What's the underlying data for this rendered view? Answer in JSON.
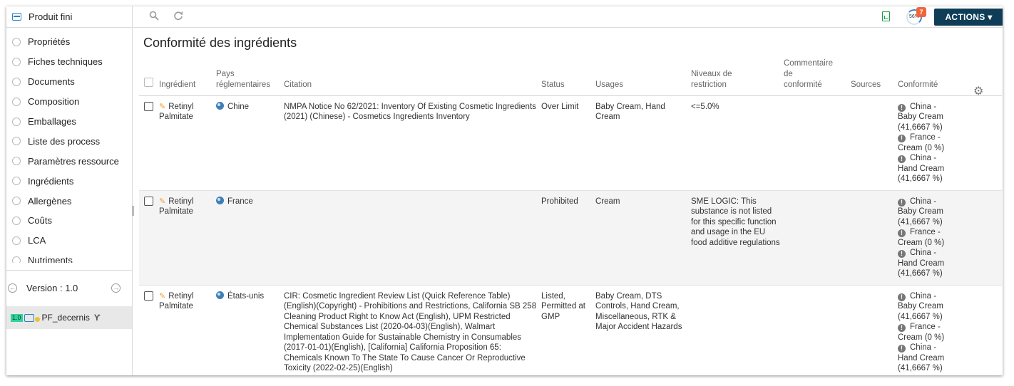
{
  "sidebar": {
    "header": "Produit fini",
    "items": [
      "Propriétés",
      "Fiches techniques",
      "Documents",
      "Composition",
      "Emballages",
      "Liste des process",
      "Paramètres ressource",
      "Ingrédients",
      "Allergènes",
      "Coûts",
      "LCA",
      "Nutriments"
    ],
    "version_label": "Version : 1.0",
    "branch": {
      "version_badge": "1.0",
      "name": "PF_decernis",
      "branch_icon": "Ƴ"
    }
  },
  "toolbar": {
    "search_icon": "magnifier",
    "refresh_icon": "refresh",
    "progress": "56%",
    "notifications": "7",
    "actions_label": "ACTIONS ▾"
  },
  "page_title": "Conformité des ingrédients",
  "table": {
    "headers": {
      "ingredient": "Ingrédient",
      "pays_1": "Pays",
      "pays_2": "réglementaires",
      "citation": "Citation",
      "status": "Status",
      "usages": "Usages",
      "niveaux_1": "Niveaux de",
      "niveaux_2": "restriction",
      "commentaire_1": "Commentaire",
      "commentaire_2": "de",
      "commentaire_3": "conformité",
      "sources": "Sources",
      "conformite": "Conformité"
    },
    "rows": [
      {
        "ingredient_1": "Retinyl",
        "ingredient_2": "Palmitate",
        "pays": "Chine",
        "citation": "NMPA Notice No 62/2021: Inventory Of Existing Cosmetic Ingredients (2021) (Chinese) - Cosmetics Ingredients Inventory",
        "status": "Over Limit",
        "usages": "Baby Cream, Hand Cream",
        "niveaux": "<=5.0%",
        "conformite": [
          {
            "l1": "China -",
            "l2": "Baby Cream",
            "l3": "(41,6667 %)"
          },
          {
            "l1": "France -",
            "l2": "Cream (0 %)",
            "l3": ""
          },
          {
            "l1": "China -",
            "l2": "Hand Cream",
            "l3": "(41,6667 %)"
          }
        ]
      },
      {
        "ingredient_1": "Retinyl",
        "ingredient_2": "Palmitate",
        "pays": "France",
        "citation": "",
        "status": "Prohibited",
        "usages": "Cream",
        "niveaux": "SME LOGIC: This substance is not listed for this specific function and usage in the EU food additive regulations",
        "conformite": [
          {
            "l1": "China -",
            "l2": "Baby Cream",
            "l3": "(41,6667 %)"
          },
          {
            "l1": "France -",
            "l2": "Cream (0 %)",
            "l3": ""
          },
          {
            "l1": "China -",
            "l2": "Hand Cream",
            "l3": "(41,6667 %)"
          }
        ]
      },
      {
        "ingredient_1": "Retinyl",
        "ingredient_2": "Palmitate",
        "pays": "États-unis",
        "citation": "CIR: Cosmetic Ingredient Review List (Quick Reference Table) (English)(Copyright) - Prohibitions and Restrictions, California SB 258 Cleaning Product Right to Know Act (English), UPM Restricted Chemical Substances List (2020-04-03)(English), Walmart Implementation Guide for Sustainable Chemistry in Consumables (2017-01-01)(English), [California] California Proposition 65: Chemicals Known To The State To Cause Cancer Or Reproductive Toxicity (2022-02-25)(English)",
        "status": "Listed, Permitted at GMP",
        "usages": "Baby Cream, DTS Controls, Hand Cream, Miscellaneous, RTK & Major Accident Hazards",
        "niveaux": "",
        "conformite": [
          {
            "l1": "China -",
            "l2": "Baby Cream",
            "l3": "(41,6667 %)"
          },
          {
            "l1": "France -",
            "l2": "Cream (0 %)",
            "l3": ""
          },
          {
            "l1": "China -",
            "l2": "Hand Cream",
            "l3": "(41,6667 %)"
          }
        ]
      }
    ]
  }
}
